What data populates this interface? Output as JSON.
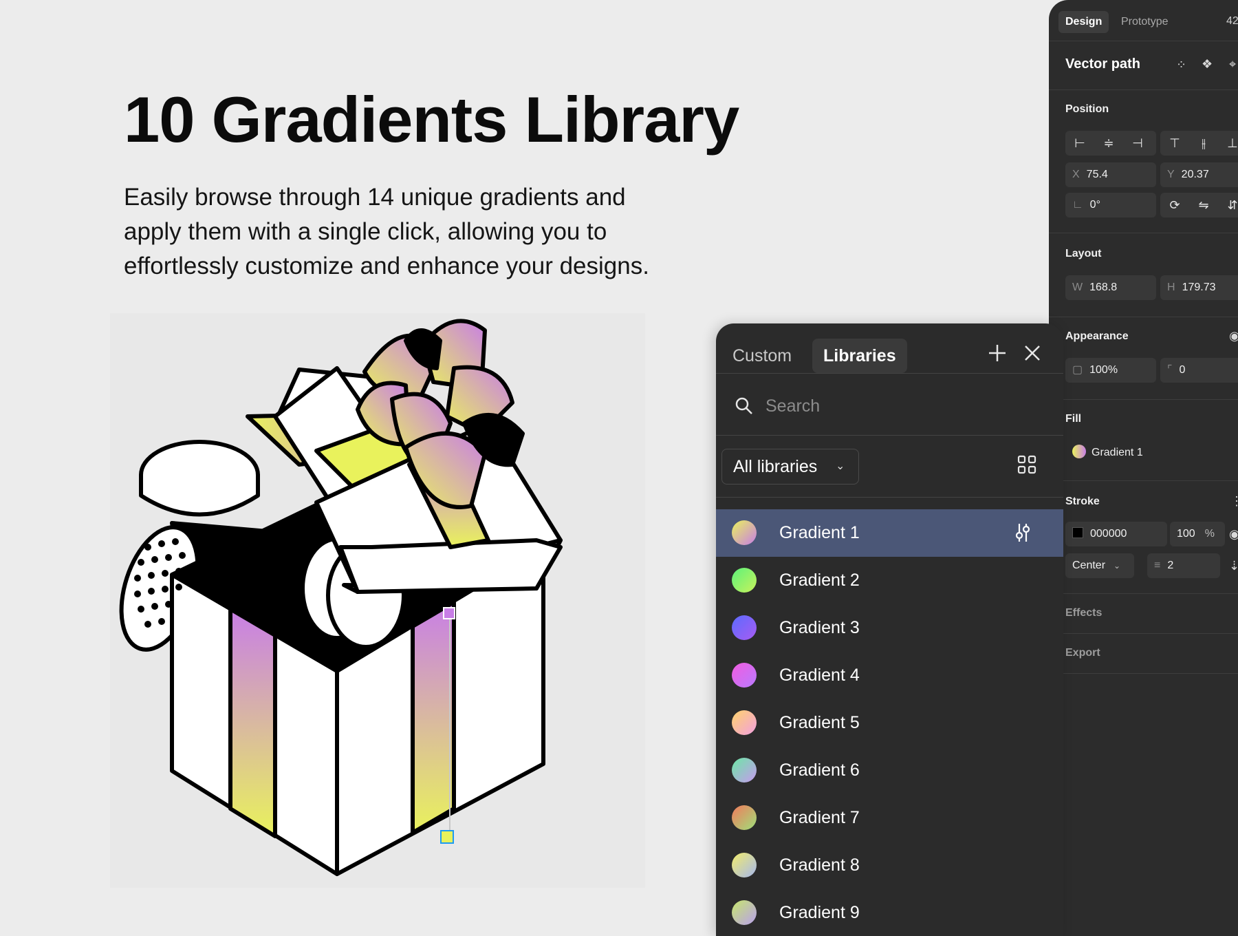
{
  "hero": {
    "title": "10 Gradients Library",
    "description": "Easily browse through 14 unique gradients and apply them with a single click, allowing you to effortlessly customize and enhance your designs."
  },
  "design_panel": {
    "tabs": [
      "Design",
      "Prototype"
    ],
    "truncated_number": "42",
    "selection_title": "Vector path",
    "position": {
      "label": "Position",
      "x_label": "X",
      "x": "75.4",
      "y_label": "Y",
      "y": "20.37",
      "rotation": "0°"
    },
    "layout": {
      "label": "Layout",
      "w_label": "W",
      "w": "168.8",
      "h_label": "H",
      "h": "179.73"
    },
    "appearance": {
      "label": "Appearance",
      "opacity": "100%",
      "radius": "0"
    },
    "fill": {
      "label": "Fill",
      "value": "Gradient 1"
    },
    "stroke": {
      "label": "Stroke",
      "color": "000000",
      "opacity": "100",
      "percent": "%",
      "position": "Center",
      "weight": "2"
    },
    "effects_label": "Effects",
    "export_label": "Export"
  },
  "library_panel": {
    "tabs": {
      "custom": "Custom",
      "libraries": "Libraries"
    },
    "search_placeholder": "Search",
    "filter": "All libraries",
    "items": [
      {
        "name": "Gradient 1",
        "colors": [
          "#e9f25c",
          "#c87ee6"
        ],
        "selected": true
      },
      {
        "name": "Gradient 2",
        "colors": [
          "#5cf27a",
          "#c8f25c"
        ],
        "selected": false
      },
      {
        "name": "Gradient 3",
        "colors": [
          "#5b6bff",
          "#a85cf2"
        ],
        "selected": false
      },
      {
        "name": "Gradient 4",
        "colors": [
          "#f25ce0",
          "#b97bff"
        ],
        "selected": false
      },
      {
        "name": "Gradient 5",
        "colors": [
          "#ffd36b",
          "#f2a0e0"
        ],
        "selected": false
      },
      {
        "name": "Gradient 6",
        "colors": [
          "#6be8a4",
          "#c79aef"
        ],
        "selected": false
      },
      {
        "name": "Gradient 7",
        "colors": [
          "#f27a5c",
          "#9ee07a"
        ],
        "selected": false
      },
      {
        "name": "Gradient 8",
        "colors": [
          "#f2ec6b",
          "#a6b8ee"
        ],
        "selected": false
      },
      {
        "name": "Gradient 9",
        "colors": [
          "#c7e66b",
          "#b9a0ee"
        ],
        "selected": false
      }
    ]
  },
  "colors": {
    "canvas": "#ececec",
    "panel": "#2c2c2c",
    "selected_row": "#4b5777",
    "ribbon_top": "#c87ee6",
    "ribbon_bottom": "#e9f25c"
  }
}
